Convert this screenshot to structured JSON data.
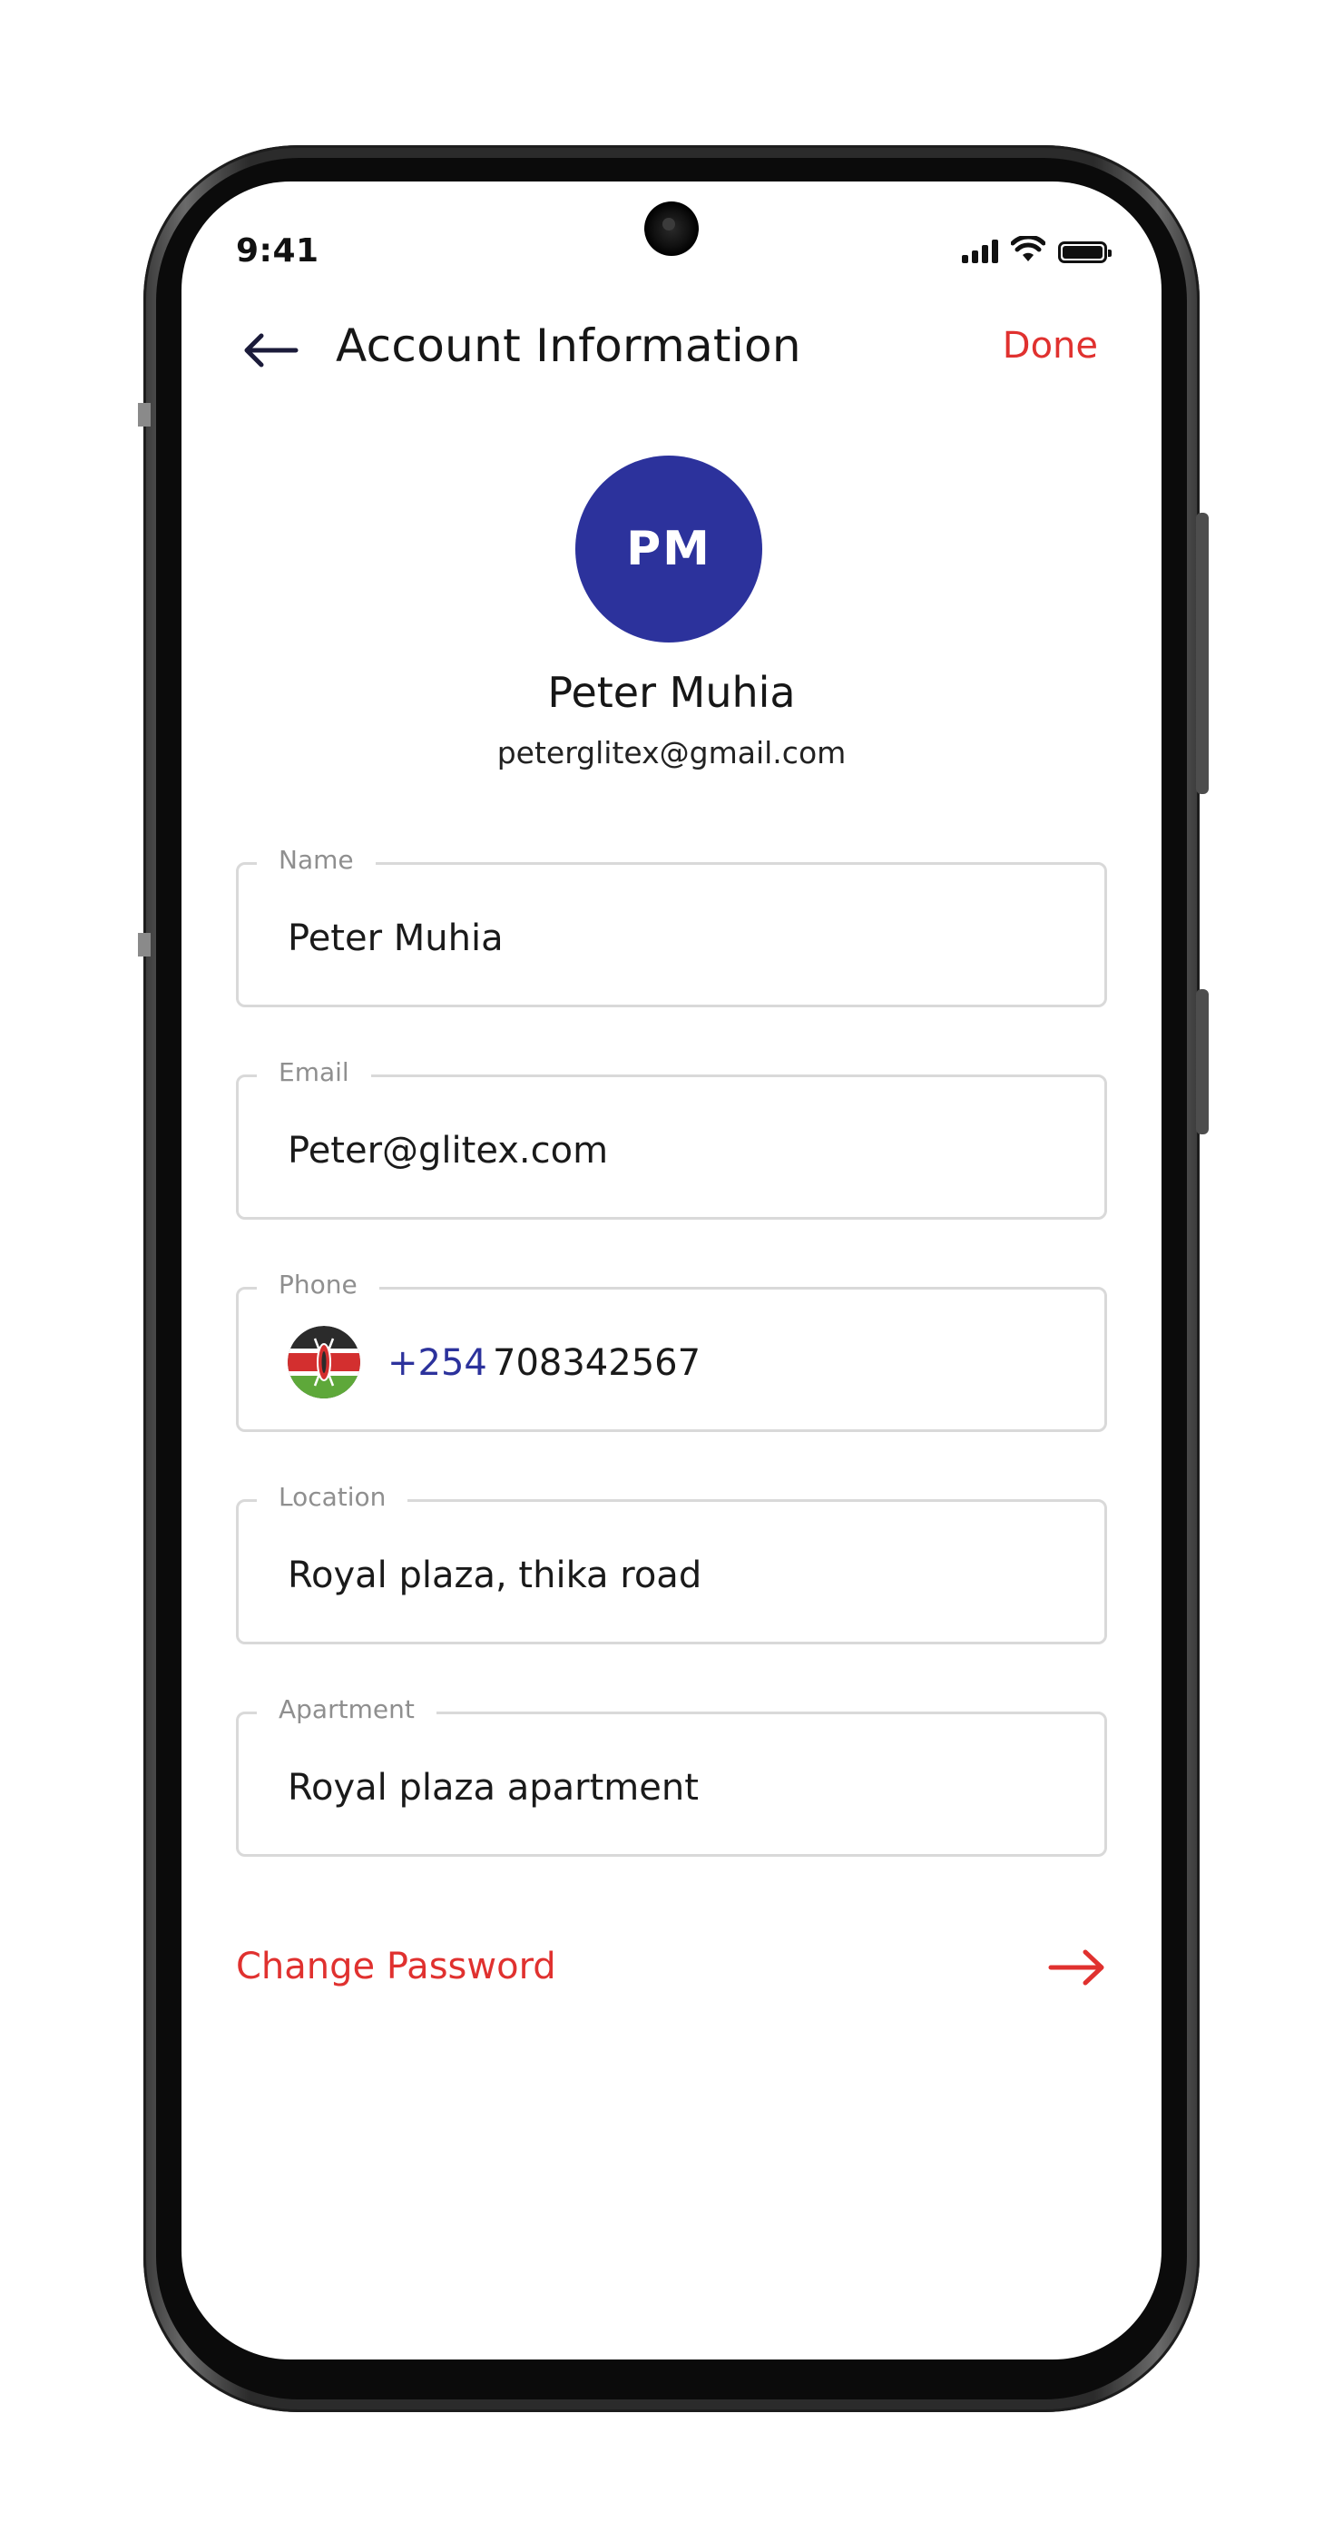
{
  "status_bar": {
    "time": "9:41",
    "icons": [
      "cellular-signal-icon",
      "wifi-icon",
      "battery-icon"
    ]
  },
  "header": {
    "back_icon": "arrow-left-icon",
    "title": "Account Information",
    "done_label": "Done"
  },
  "profile": {
    "initials": "PM",
    "name": "Peter Muhia",
    "email": "peterglitex@gmail.com"
  },
  "form": {
    "name": {
      "label": "Name",
      "value": "Peter Muhia"
    },
    "email": {
      "label": "Email",
      "value": "Peter@glitex.com"
    },
    "phone": {
      "label": "Phone",
      "flag_icon": "kenya-flag-icon",
      "dial_code": "+254",
      "number": "708342567"
    },
    "location": {
      "label": "Location",
      "value": "Royal plaza, thika road"
    },
    "apartment": {
      "label": "Apartment",
      "value": "Royal plaza apartment"
    }
  },
  "change_password": {
    "label": "Change Password",
    "icon": "arrow-right-icon"
  },
  "colors": {
    "accent_red": "#e0312f",
    "brand_blue": "#2c329c",
    "field_border": "#d9d9d9",
    "label_gray": "#8f8f8f"
  }
}
